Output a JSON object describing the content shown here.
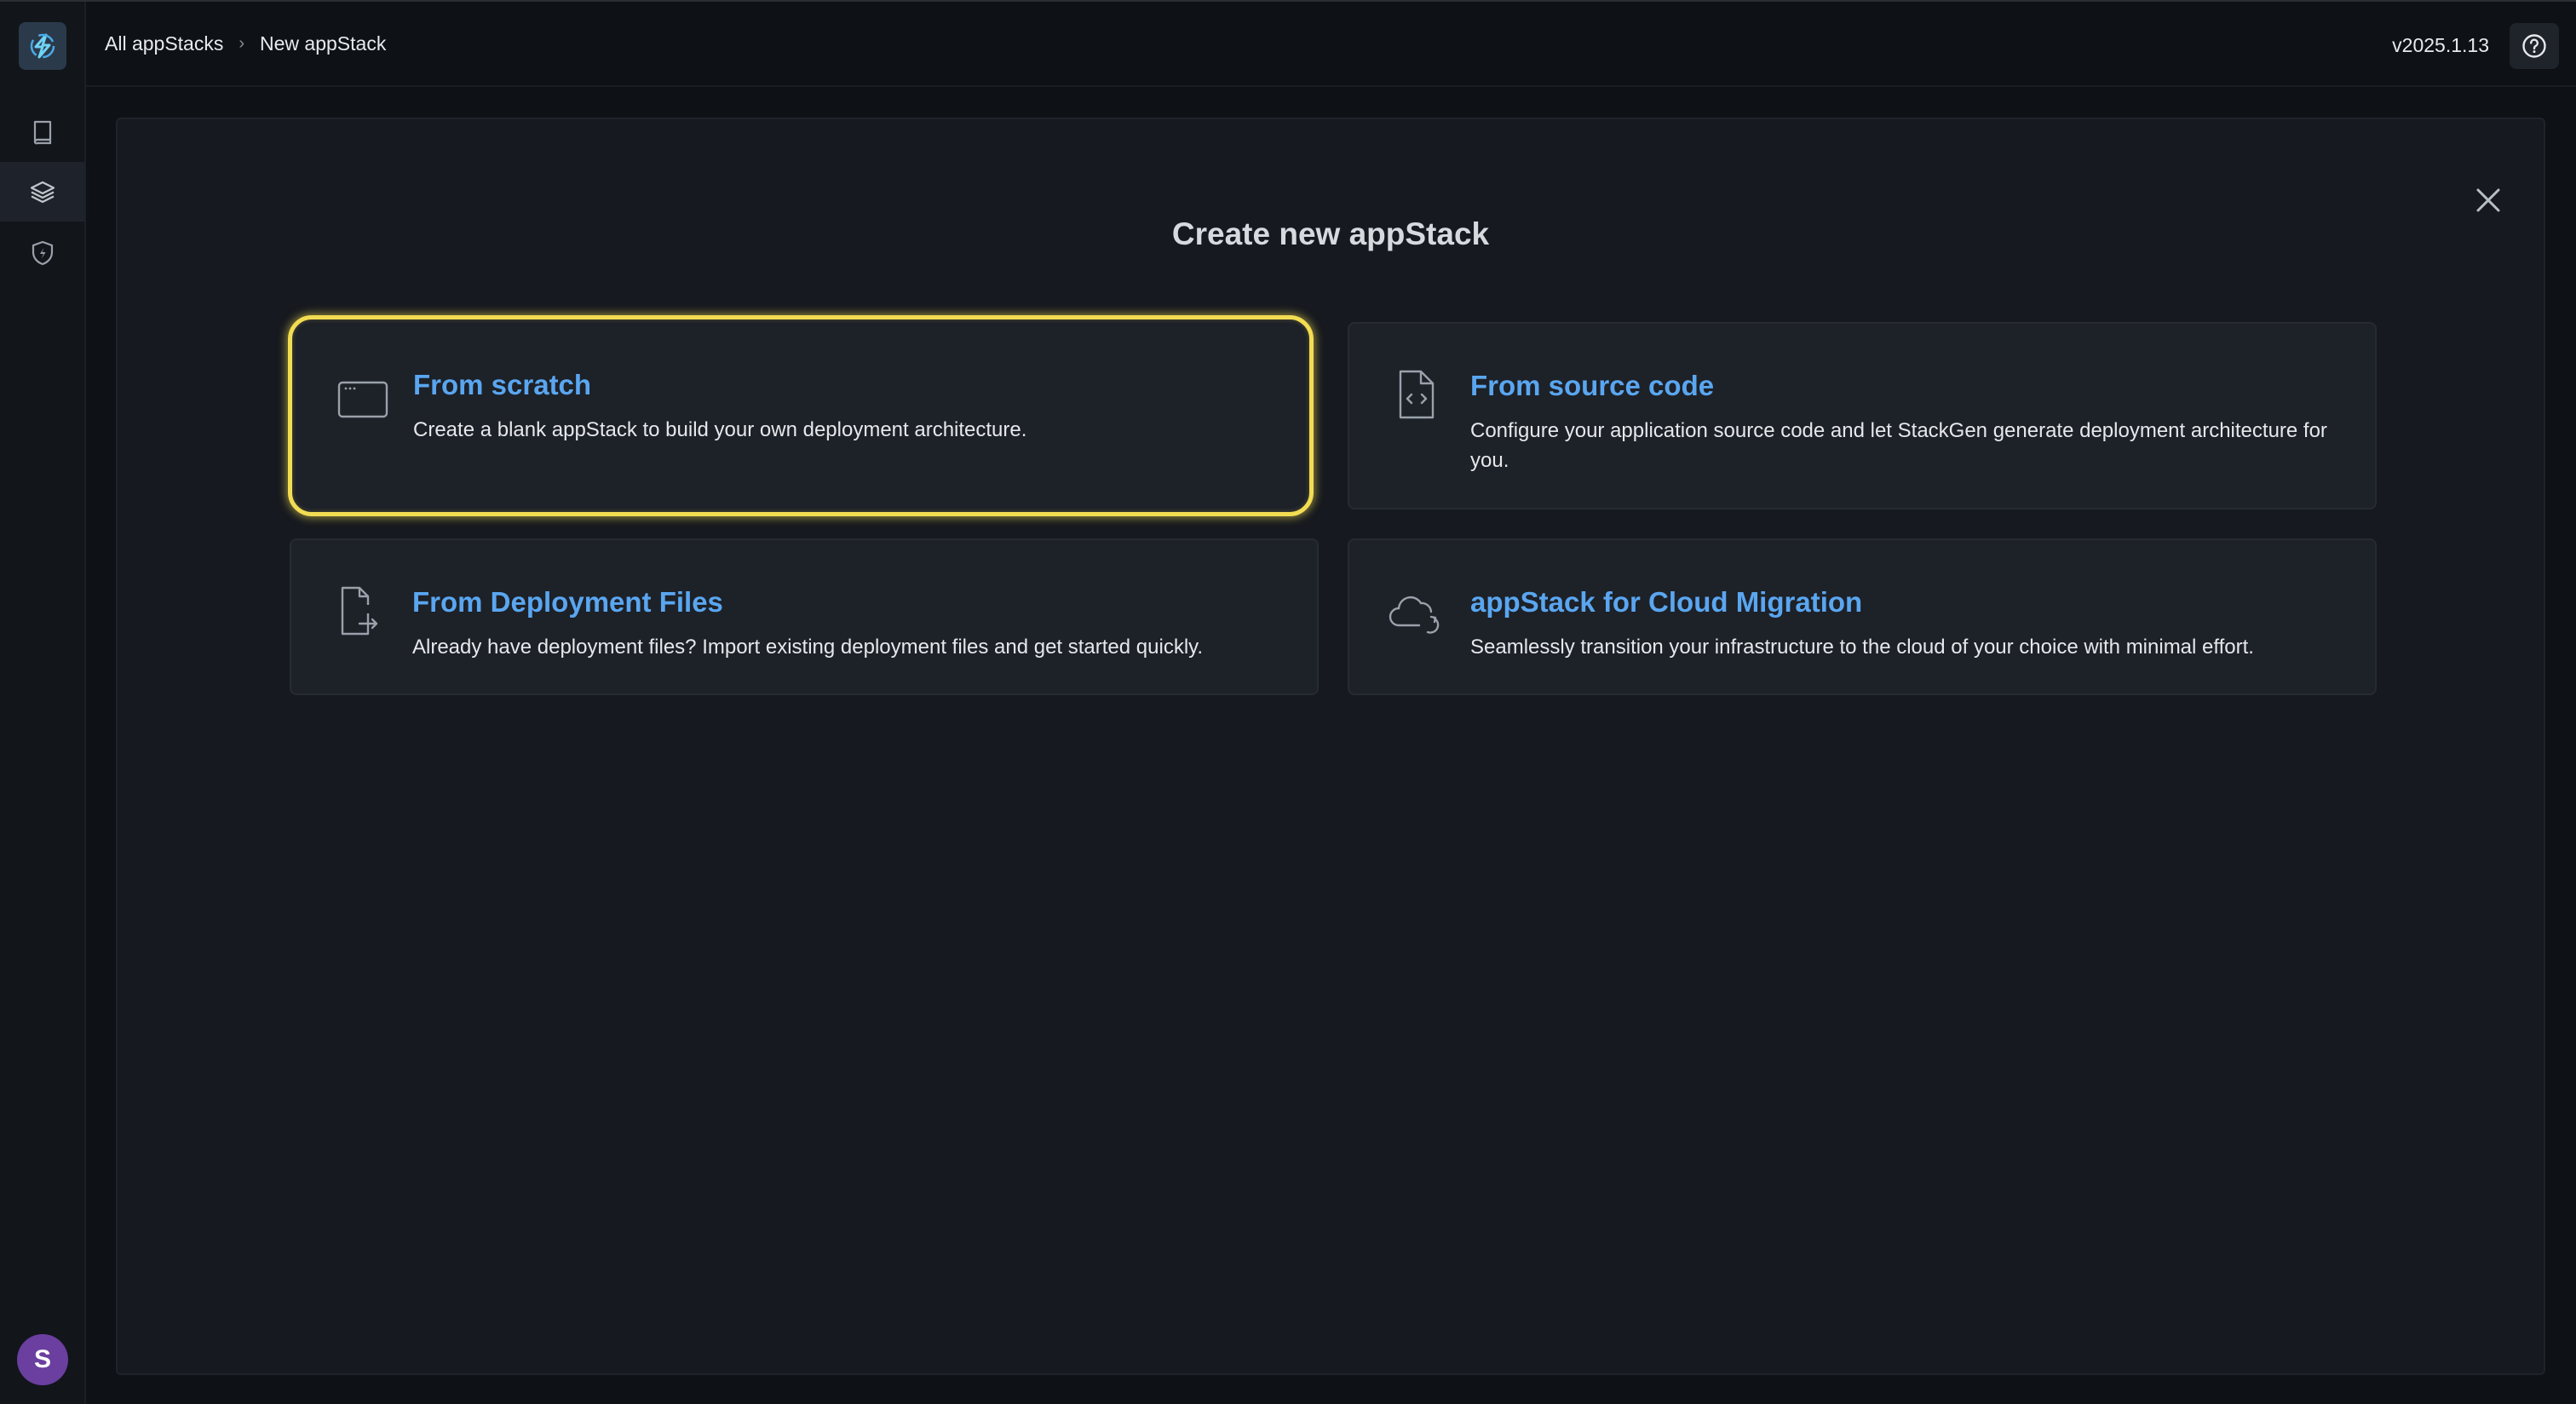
{
  "header": {
    "breadcrumb": {
      "root": "All appStacks",
      "current": "New appStack"
    },
    "version": "v2025.1.13"
  },
  "sidebar": {
    "items": [
      {
        "name": "catalog",
        "icon": "book-icon"
      },
      {
        "name": "appstacks",
        "icon": "layers-icon",
        "active": true
      },
      {
        "name": "policies",
        "icon": "shield-icon"
      }
    ],
    "avatar_initial": "S"
  },
  "modal": {
    "title": "Create new appStack",
    "options": [
      {
        "title": "From scratch",
        "description": "Create a blank appStack to build your own deployment architecture.",
        "icon": "blank-window-icon",
        "selected": true
      },
      {
        "title": "From source code",
        "description": "Configure your application source code and let StackGen generate deployment architecture for you.",
        "icon": "code-file-icon"
      },
      {
        "title": "From Deployment Files",
        "description": "Already have deployment files? Import existing deployment files and get started quickly.",
        "icon": "file-import-icon"
      },
      {
        "title": "appStack for Cloud Migration",
        "description": "Seamlessly transition your infrastructure to the cloud of your choice with minimal effort.",
        "icon": "cloud-migrate-icon"
      }
    ]
  },
  "colors": {
    "accent": "#5aa6f0",
    "highlight": "#f2dc52",
    "background": "#0e1116",
    "card": "#1d2128",
    "avatar": "#6b3fa0"
  }
}
